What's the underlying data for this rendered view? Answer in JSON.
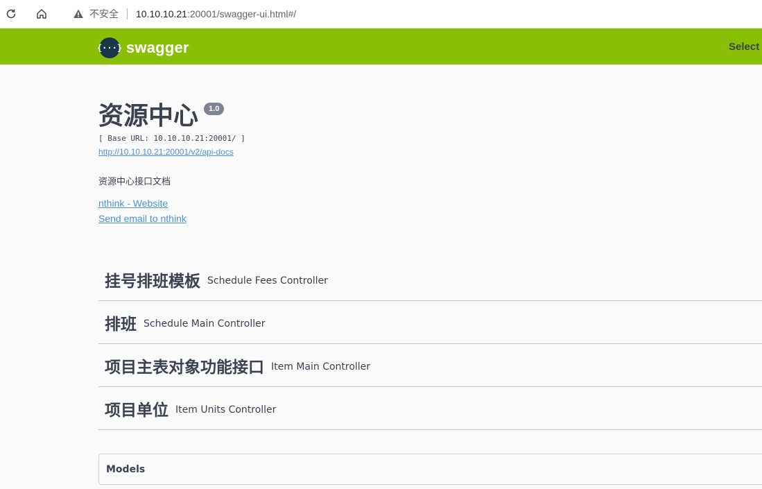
{
  "browser": {
    "insecure_label": "不安全",
    "url_host": "10.10.10.21",
    "url_rest": ":20001/swagger-ui.html#/"
  },
  "topbar": {
    "logo_text": "swagger",
    "logo_mark": "{···}",
    "select_label": "Select a",
    "color": "#89bf04"
  },
  "info": {
    "title": "资源中心",
    "version": "1.0",
    "base_url": "[ Base URL: 10.10.10.21:20001/ ]",
    "api_docs_link": "http://10.10.10.21:20001/v2/api-docs",
    "description": "资源中心接口文档",
    "website_link": "nthink - Website",
    "email_link": "Send email to nthink"
  },
  "tags": [
    {
      "name": "挂号排班模板",
      "controller": "Schedule Fees Controller"
    },
    {
      "name": "排班",
      "controller": "Schedule Main Controller"
    },
    {
      "name": "项目主表对象功能接口",
      "controller": "Item Main Controller"
    },
    {
      "name": "项目单位",
      "controller": "Item Units Controller"
    }
  ],
  "models": {
    "label": "Models"
  }
}
